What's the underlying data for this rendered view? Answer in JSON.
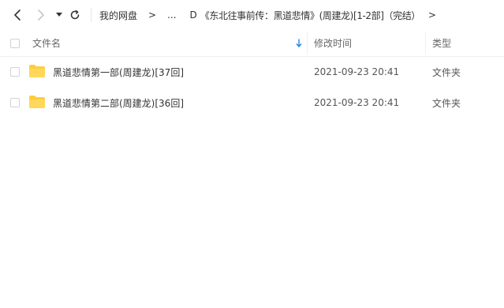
{
  "toolbar": {
    "back_icon": "chevron-left-icon",
    "forward_icon": "chevron-right-icon",
    "dropdown_icon": "caret-down-icon",
    "refresh_icon": "refresh-icon"
  },
  "breadcrumb": {
    "items": [
      "我的网盘",
      ">",
      "...",
      "D",
      "《东北往事前传：黑道悲情》(周建龙)[1-2部]（完结）",
      ">"
    ]
  },
  "table": {
    "columns": {
      "name": "文件名",
      "modified": "修改时间",
      "type": "类型"
    },
    "sort_icon": "sort-down-arrow-icon",
    "rows": [
      {
        "name": "黑道悲情第一部(周建龙)[37回]",
        "modified": "2021-09-23 20:41",
        "type": "文件夹"
      },
      {
        "name": "黑道悲情第二部(周建龙)[36回]",
        "modified": "2021-09-23 20:41",
        "type": "文件夹"
      }
    ]
  },
  "colors": {
    "folder": "#ffcd3c",
    "accent": "#1e88e5",
    "divider": "#eef0f3"
  }
}
